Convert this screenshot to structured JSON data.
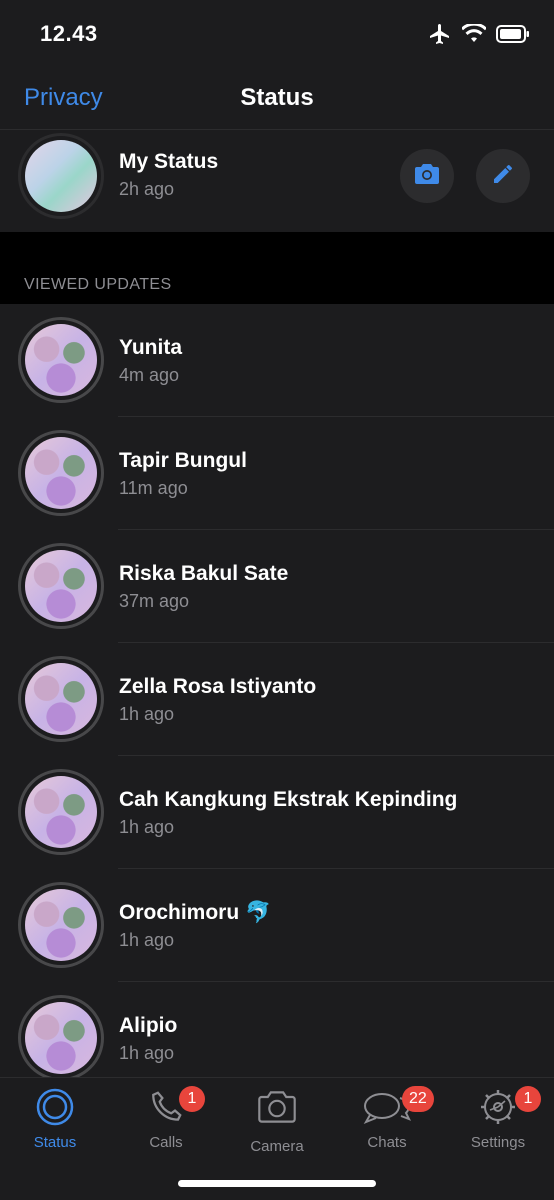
{
  "status_bar": {
    "time": "12.43"
  },
  "nav": {
    "left_link": "Privacy",
    "title": "Status"
  },
  "my_status": {
    "name": "My Status",
    "time": "2h ago"
  },
  "section": {
    "viewed_label": "VIEWED UPDATES"
  },
  "updates": [
    {
      "name": "Yunita",
      "time": "4m ago"
    },
    {
      "name": "Tapir Bungul",
      "time": "11m ago"
    },
    {
      "name": "Riska Bakul Sate",
      "time": "37m ago"
    },
    {
      "name": "Zella Rosa Istiyanto",
      "time": "1h ago"
    },
    {
      "name": "Cah Kangkung Ekstrak Kepinding",
      "time": "1h ago"
    },
    {
      "name": "Orochimoru 🐬",
      "time": "1h ago"
    },
    {
      "name": "Alipio",
      "time": "1h ago"
    }
  ],
  "tabs": [
    {
      "label": "Status",
      "icon": "status-icon",
      "badge": ""
    },
    {
      "label": "Calls",
      "icon": "phone-icon",
      "badge": "1"
    },
    {
      "label": "Camera",
      "icon": "camera-icon",
      "badge": ""
    },
    {
      "label": "Chats",
      "icon": "chat-bubbles-icon",
      "badge": "22"
    },
    {
      "label": "Settings",
      "icon": "gear-icon",
      "badge": "1"
    }
  ],
  "colors": {
    "accent": "#3f8ae8",
    "badge": "#e8453c",
    "background": "#1c1c1e"
  }
}
